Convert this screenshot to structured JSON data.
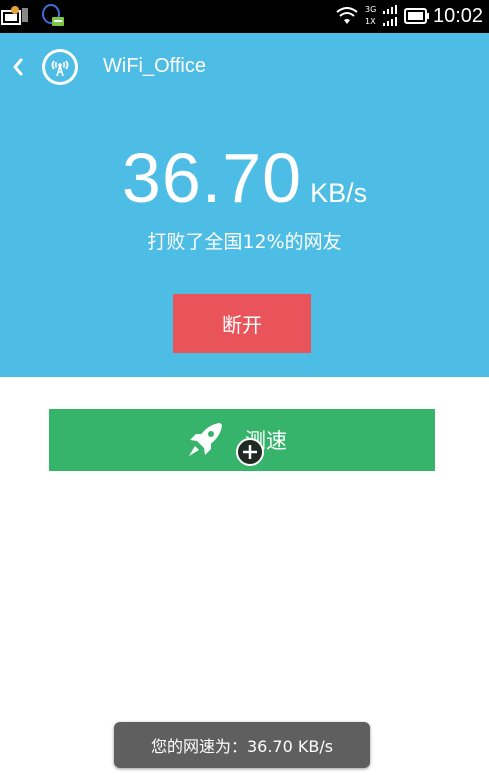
{
  "status_bar": {
    "network_top": "3G",
    "network_bottom": "1X",
    "time": "10:02"
  },
  "header": {
    "back_icon": "chevron-left-icon",
    "wifi_icon": "wifi-tower-icon",
    "ssid": "WiFi_Office"
  },
  "speed": {
    "value": "36.70",
    "unit": "KB/s",
    "beat_text": "打败了全国12%的网友"
  },
  "buttons": {
    "disconnect": "断开",
    "speed_test": "测速"
  },
  "toast": {
    "text": "您的网速为：36.70 KB/s"
  },
  "colors": {
    "hero_bg": "#4dbde6",
    "disconnect_bg": "#e9545a",
    "speedtest_bg": "#37b46c",
    "toast_bg": "#5f5f5f"
  }
}
